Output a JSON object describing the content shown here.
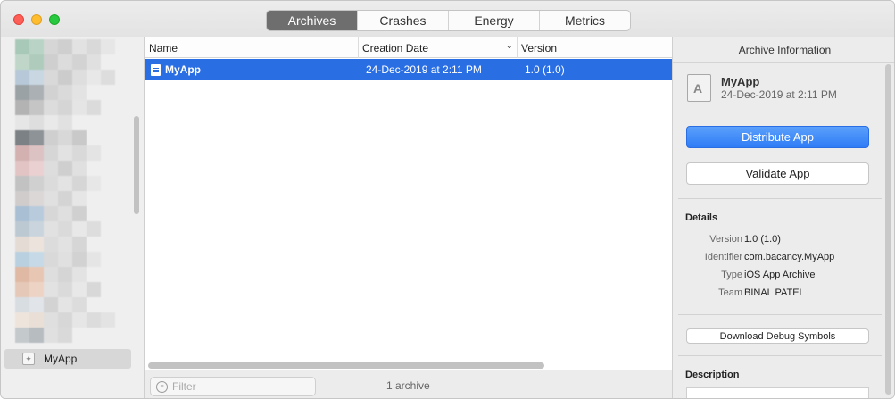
{
  "toolbar": {
    "tabs": [
      {
        "label": "Archives",
        "active": true
      },
      {
        "label": "Crashes",
        "active": false
      },
      {
        "label": "Energy",
        "active": false
      },
      {
        "label": "Metrics",
        "active": false
      }
    ]
  },
  "sidebar": {
    "selected_item": "MyApp"
  },
  "list": {
    "columns": [
      "Name",
      "Creation Date",
      "Version"
    ],
    "sorted_column": "Creation Date",
    "rows": [
      {
        "name": "MyApp",
        "creation_date": "24-Dec-2019 at 2:11 PM",
        "version": "1.0 (1.0)",
        "selected": true
      }
    ],
    "filter_placeholder": "Filter",
    "count_label": "1 archive"
  },
  "inspector": {
    "title": "Archive Information",
    "app_name": "MyApp",
    "app_date": "24-Dec-2019 at 2:11 PM",
    "distribute_label": "Distribute App",
    "validate_label": "Validate App",
    "details_title": "Details",
    "details": {
      "version_label": "Version",
      "version_value": "1.0 (1.0)",
      "identifier_label": "Identifier",
      "identifier_value": "com.bacancy.MyApp",
      "type_label": "Type",
      "type_value": "iOS App Archive",
      "team_label": "Team",
      "team_value": "BINAL PATEL"
    },
    "download_symbols_label": "Download Debug Symbols",
    "description_title": "Description"
  },
  "colors": {
    "selection": "#2a6ee3",
    "primary_button": "#2f7cf6",
    "segment_active": "#6e6e6e"
  },
  "icons": [
    "close-icon",
    "minimize-icon",
    "zoom-icon",
    "archive-icon",
    "document-icon",
    "filter-icon",
    "app-archive-icon",
    "sort-chevron-icon"
  ]
}
